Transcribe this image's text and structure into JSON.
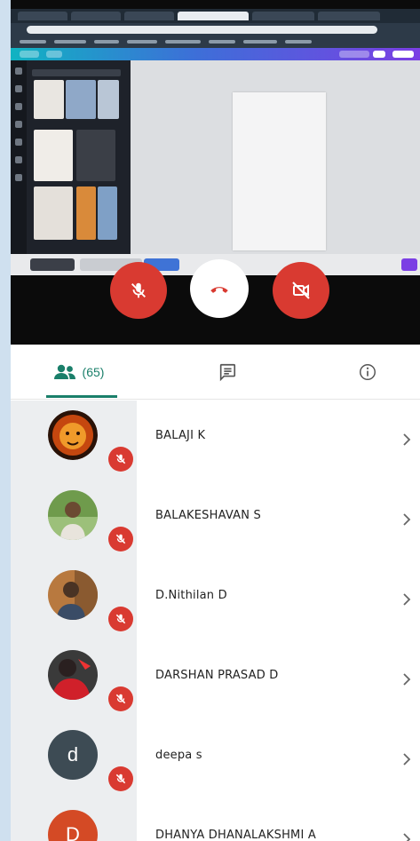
{
  "tabs": {
    "people_count": "(65)"
  },
  "participants": [
    {
      "name": "BALAJI K",
      "muted": true,
      "avatar": "lion-photo"
    },
    {
      "name": "BALAKESHAVAN S",
      "muted": true,
      "avatar": "person-photo"
    },
    {
      "name": "D.Nithilan D",
      "muted": true,
      "avatar": "person-photo"
    },
    {
      "name": "DARSHAN PRASAD D",
      "muted": true,
      "avatar": "red-photo"
    },
    {
      "name": "deepa s",
      "muted": true,
      "avatar_letter": "d",
      "avatar_color": "#3d4b54"
    },
    {
      "name": "DHANYA DHANALAKSHMI A",
      "muted": false,
      "avatar_letter": "D",
      "avatar_color": "#d44a25"
    }
  ],
  "colors": {
    "accent": "#1a7f6a",
    "danger": "#d93a31"
  }
}
